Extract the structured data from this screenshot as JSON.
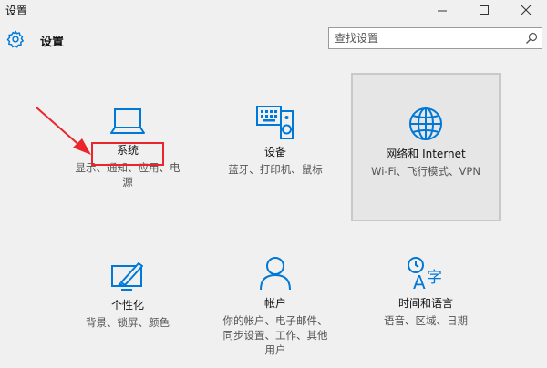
{
  "window": {
    "title": "设置",
    "minimize_glyph": "—",
    "maximize_glyph": "☐",
    "close_glyph": "✕"
  },
  "header": {
    "app_title": "设置",
    "icon": "gear-icon"
  },
  "search": {
    "placeholder": "查找设置",
    "value": "",
    "icon": "search-icon"
  },
  "tiles": [
    {
      "id": "system",
      "icon": "laptop-icon",
      "title": "系统",
      "desc_lines": [
        "显示、通知、应用、电",
        "源"
      ],
      "highlighted": true
    },
    {
      "id": "devices",
      "icon": "keyboard-speaker-icon",
      "title": "设备",
      "desc_lines": [
        "蓝牙、打印机、鼠标"
      ]
    },
    {
      "id": "network",
      "icon": "globe-icon",
      "title": "网络和 Internet",
      "desc_lines": [
        "Wi-Fi、飞行模式、VPN"
      ],
      "hovered": true
    },
    {
      "id": "personalization",
      "icon": "paint-brush-icon",
      "title": "个性化",
      "desc_lines": [
        "背景、锁屏、颜色"
      ]
    },
    {
      "id": "accounts",
      "icon": "person-icon",
      "title": "帐户",
      "desc_lines": [
        "你的帐户、电子邮件、",
        "同步设置、工作、其他",
        "用户"
      ]
    },
    {
      "id": "time-language",
      "icon": "time-language-icon",
      "title": "时间和语言",
      "desc_lines": [
        "语音、区域、日期"
      ]
    }
  ],
  "colors": {
    "accent": "#0078d7",
    "annotation_red": "#e8262b",
    "background": "#f0f0f0"
  }
}
